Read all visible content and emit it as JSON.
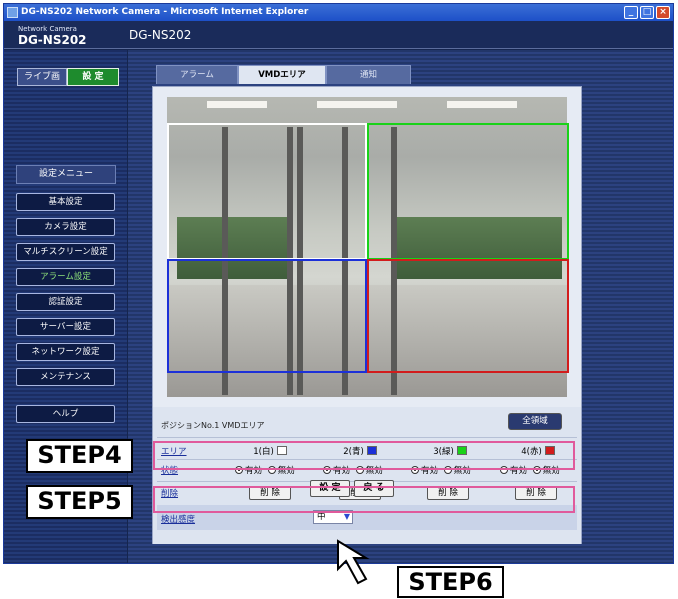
{
  "window": {
    "title": "DG-NS202 Network Camera - Microsoft Internet Explorer"
  },
  "header": {
    "brand_small": "Network Camera",
    "brand_model": "DG-NS202",
    "page_model": "DG-NS202"
  },
  "mode": {
    "live_label": "ライブ画",
    "setup_label": "設 定"
  },
  "sidebar": {
    "menu_title": "設定メニュー",
    "items": [
      {
        "label": "基本設定"
      },
      {
        "label": "カメラ設定"
      },
      {
        "label": "マルチスクリーン設定"
      },
      {
        "label": "アラーム設定"
      },
      {
        "label": "認証設定"
      },
      {
        "label": "サーバー設定"
      },
      {
        "label": "ネットワーク設定"
      },
      {
        "label": "メンテナンス"
      },
      {
        "label": "ヘルプ"
      }
    ]
  },
  "tabs": [
    {
      "label": "アラーム"
    },
    {
      "label": "VMDエリア"
    },
    {
      "label": "通知"
    }
  ],
  "vmd": {
    "position_title": "ポジションNo.1 VMDエリア",
    "full_button": "全領域",
    "area_label": "エリア",
    "state_label": "状態",
    "delete_label": "削除",
    "sensitivity_label": "検出感度",
    "sensitivity_value": "中",
    "enabled": "有効",
    "disabled": "無効",
    "delete_button": "削 除",
    "areas": [
      {
        "name": "1(白)",
        "color": "#ffffff",
        "state": "enabled"
      },
      {
        "name": "2(青)",
        "color": "#1c30d8",
        "state": "enabled"
      },
      {
        "name": "3(緑)",
        "color": "#19d219",
        "state": "enabled"
      },
      {
        "name": "4(赤)",
        "color": "#d21c1c",
        "state": "disabled"
      }
    ]
  },
  "footer": {
    "set_button": "設 定",
    "back_button": "戻 る"
  },
  "annotations": {
    "step4": "STEP4",
    "step5": "STEP5",
    "step6": "STEP6"
  }
}
